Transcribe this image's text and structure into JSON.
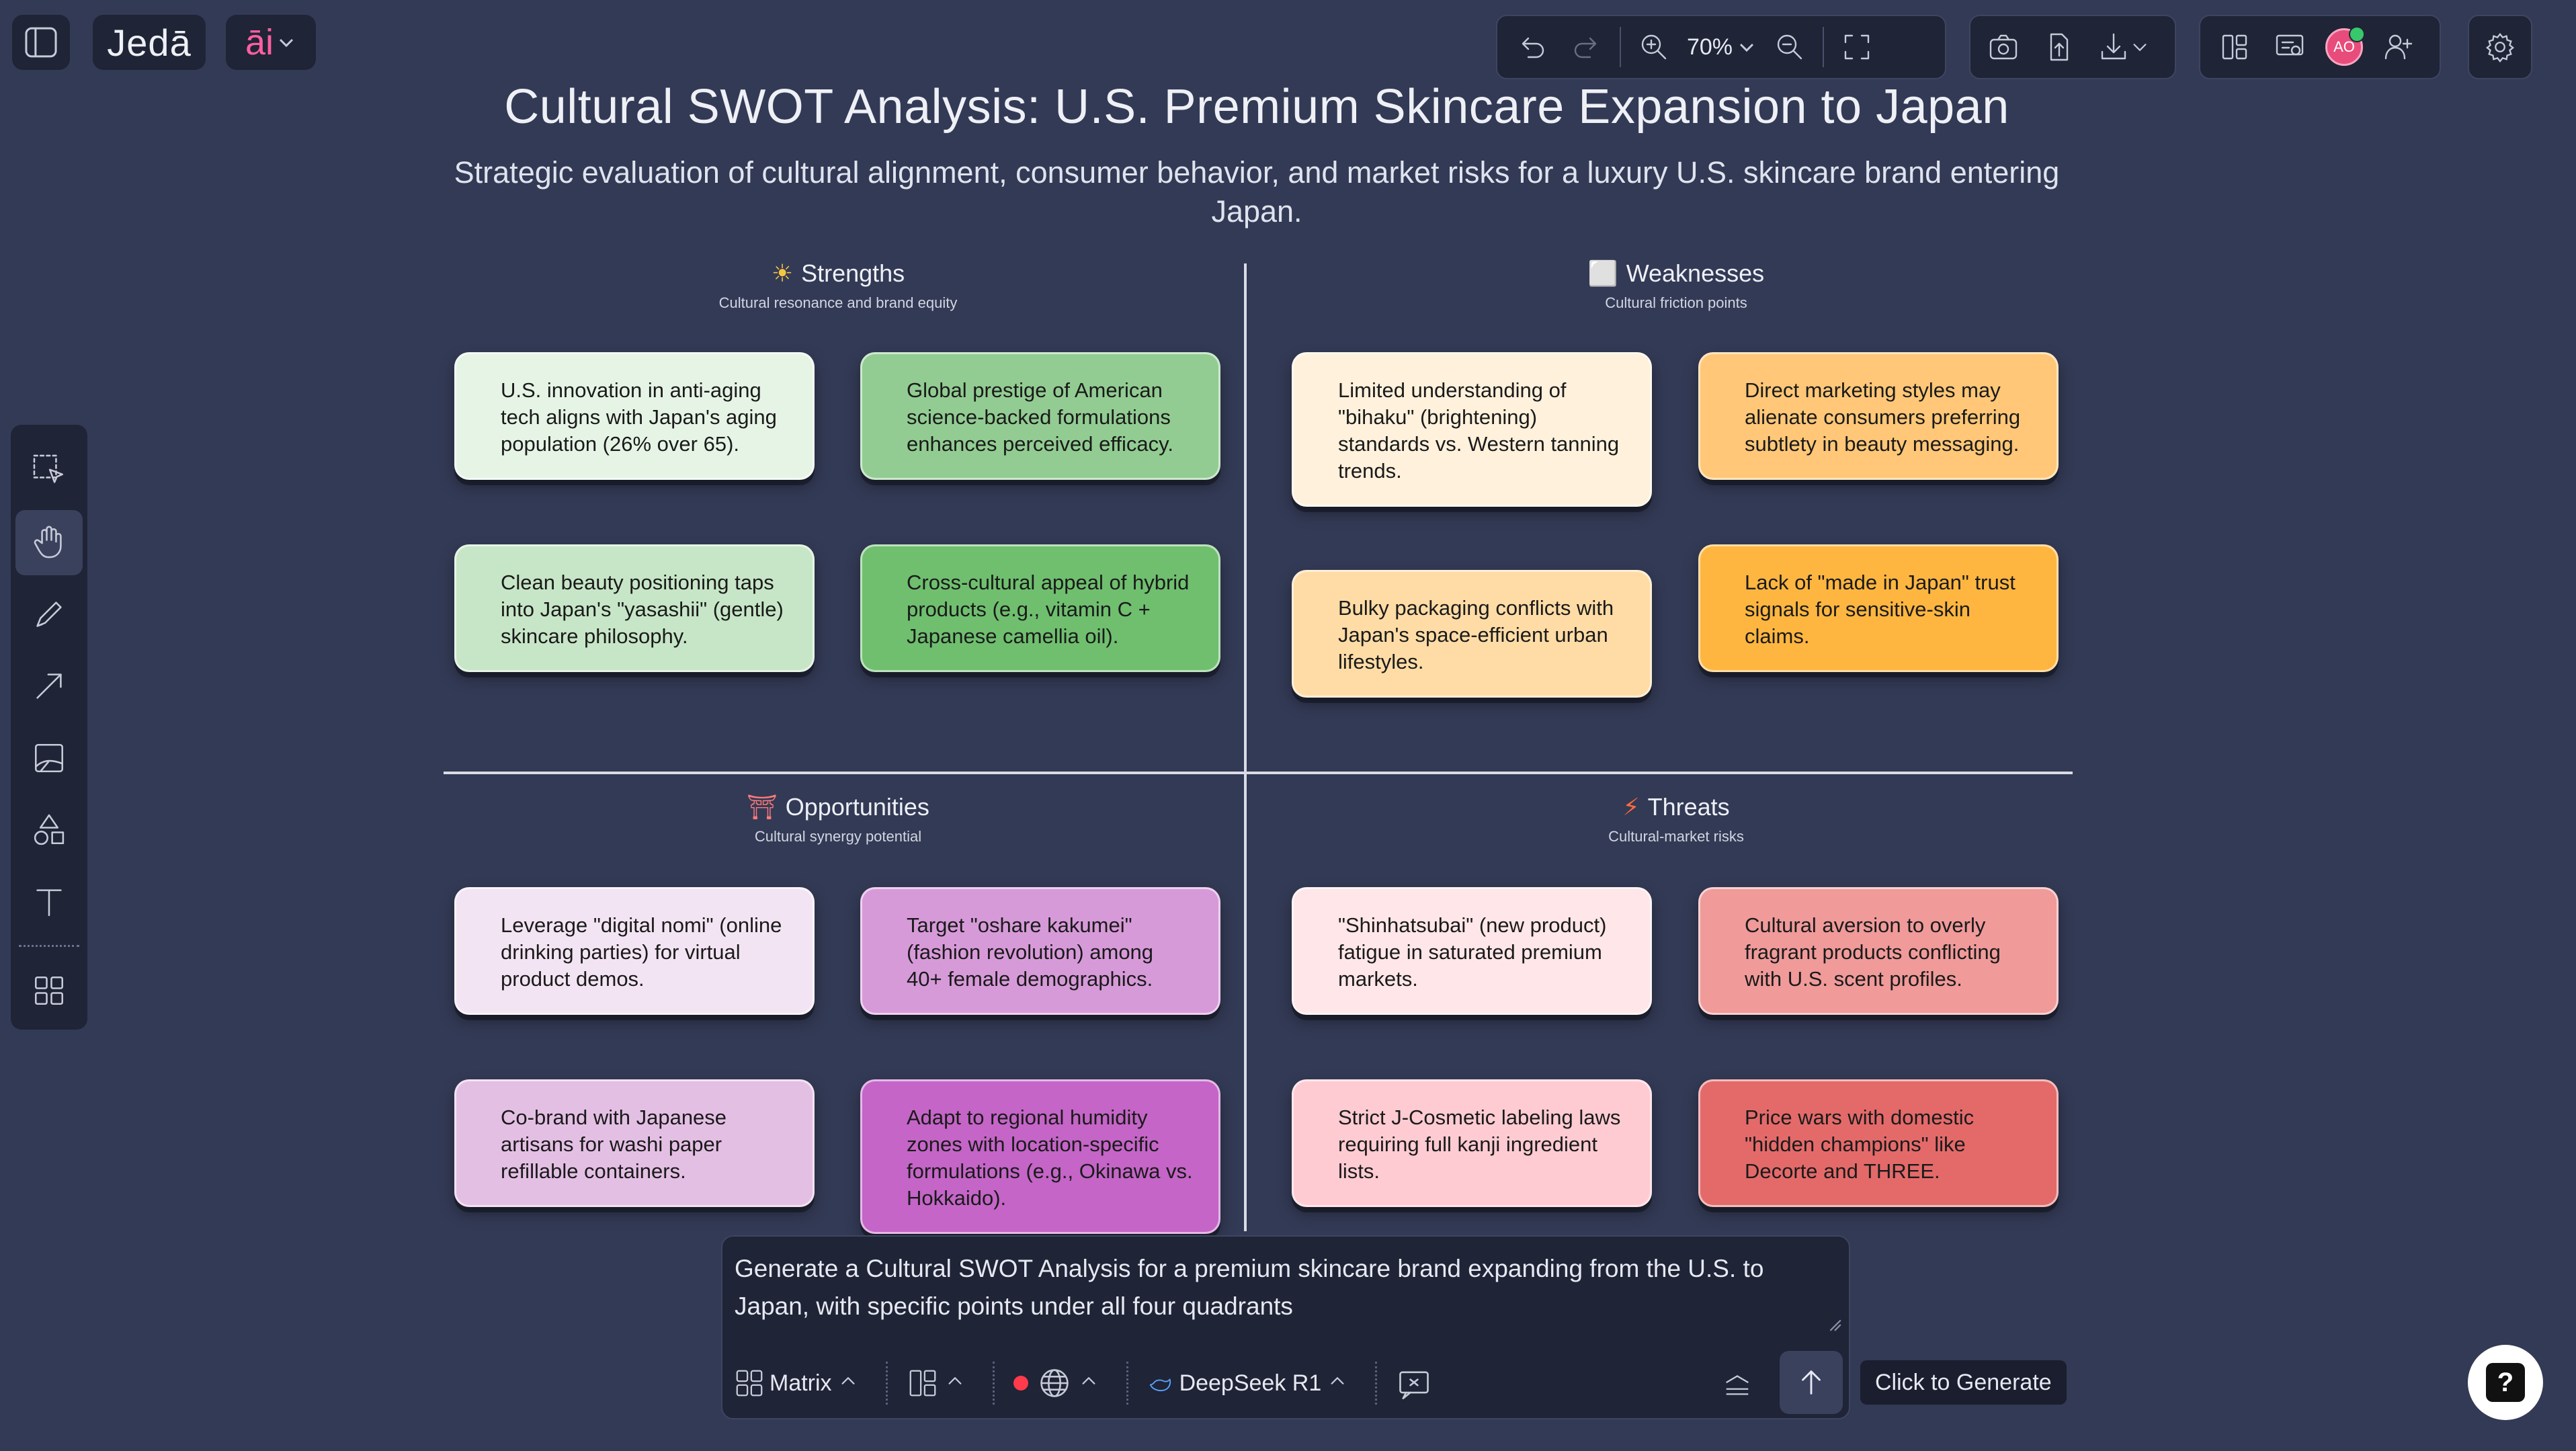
{
  "app": {
    "logo": "Jedā",
    "ai_menu_label": "āi"
  },
  "toolbar": {
    "zoom_label": "70%",
    "avatar_initials": "AO"
  },
  "canvas": {
    "title": "Cultural SWOT Analysis: U.S. Premium Skincare Expansion to Japan",
    "subtitle": "Strategic evaluation of cultural alignment, consumer behavior, and market risks for a luxury U.S. skincare brand entering Japan.",
    "quadrants": [
      {
        "key": "strengths",
        "icon": "☀",
        "title": "Strengths",
        "subtitle": "Cultural resonance and brand equity",
        "cards": [
          {
            "text": "U.S. innovation in anti-aging tech aligns with Japan's aging population (26% over 65).",
            "color": "#e6f4e6"
          },
          {
            "text": "Global prestige of American science-backed formulations enhances perceived efficacy.",
            "color": "#92cc92"
          },
          {
            "text": "Clean beauty positioning taps into Japan's \"yasashii\" (gentle) skincare philosophy.",
            "color": "#c7e6c7"
          },
          {
            "text": "Cross-cultural appeal of hybrid products (e.g., vitamin C + Japanese camellia oil).",
            "color": "#6fbf6f"
          }
        ]
      },
      {
        "key": "weaknesses",
        "icon": "⬜",
        "title": "Weaknesses",
        "subtitle": "Cultural friction points",
        "cards": [
          {
            "text": "Limited understanding of \"bihaku\" (brightening) standards vs. Western tanning trends.",
            "color": "#fff1dc"
          },
          {
            "text": "Direct marketing styles may alienate consumers preferring subtlety in beauty messaging.",
            "color": "#ffc777"
          },
          {
            "text": "Bulky packaging conflicts with Japan's space-efficient urban lifestyles.",
            "color": "#ffdca6"
          },
          {
            "text": "Lack of \"made in Japan\" trust signals for sensitive-skin claims.",
            "color": "#ffb640"
          }
        ]
      },
      {
        "key": "opportunities",
        "icon": "⛩",
        "title": "Opportunities",
        "subtitle": "Cultural synergy potential",
        "cards": [
          {
            "text": "Leverage \"digital nomi\" (online drinking parties) for virtual product demos.",
            "color": "#f3e4f3"
          },
          {
            "text": "Target \"oshare kakumei\" (fashion revolution) among 40+ female demographics.",
            "color": "#d79ad9"
          },
          {
            "text": "Co-brand with Japanese artisans for washi paper refillable containers.",
            "color": "#e4bfe4"
          },
          {
            "text": "Adapt to regional humidity zones with location-specific formulations (e.g., Okinawa vs. Hokkaido).",
            "color": "#c465c7"
          }
        ]
      },
      {
        "key": "threats",
        "icon": "⚡",
        "title": "Threats",
        "subtitle": "Cultural-market risks",
        "cards": [
          {
            "text": "\"Shinhatsubai\" (new product) fatigue in saturated premium markets.",
            "color": "#ffe6e8"
          },
          {
            "text": "Cultural aversion to overly fragrant products conflicting with U.S. scent profiles.",
            "color": "#f09a9a"
          },
          {
            "text": "Strict J-Cosmetic labeling laws requiring full kanji ingredient lists.",
            "color": "#ffcbd2"
          },
          {
            "text": "Price wars with domestic \"hidden champions\" like Decorte and THREE.",
            "color": "#e46a6a"
          }
        ]
      }
    ]
  },
  "prompt": {
    "text": "Generate a Cultural SWOT Analysis for a premium skincare brand expanding from the U.S. to Japan, with specific points under all four quadrants",
    "layout_label": "Matrix",
    "model_label": "DeepSeek R1",
    "generate_tooltip": "Click to Generate"
  },
  "help": {
    "label": "?"
  }
}
